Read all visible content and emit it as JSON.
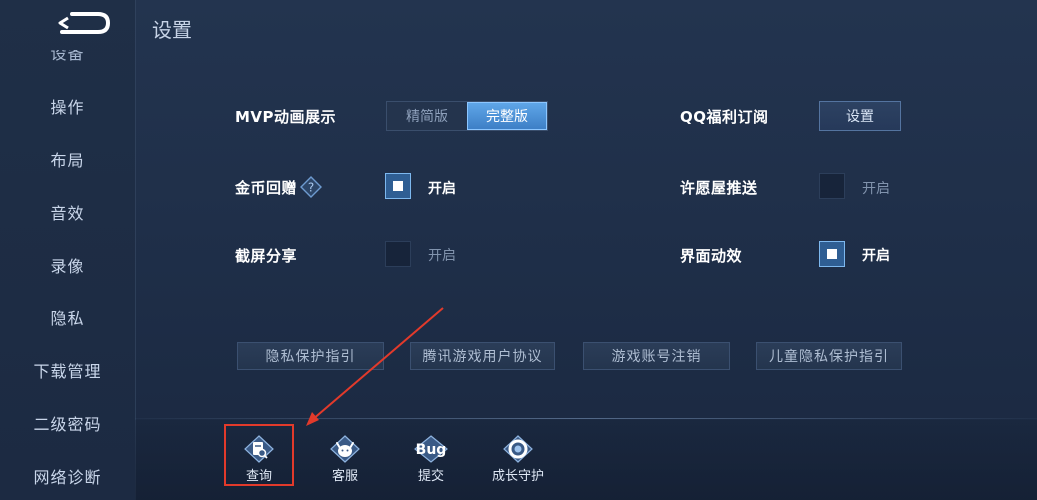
{
  "header": {
    "title": "设置"
  },
  "sidebar": {
    "items": [
      {
        "label": "设备"
      },
      {
        "label": "操作"
      },
      {
        "label": "布局"
      },
      {
        "label": "音效"
      },
      {
        "label": "录像"
      },
      {
        "label": "隐私"
      },
      {
        "label": "下载管理"
      },
      {
        "label": "二级密码"
      },
      {
        "label": "网络诊断"
      }
    ]
  },
  "settings": {
    "mvp": {
      "label": "MVP动画展示",
      "options": [
        "精简版",
        "完整版"
      ],
      "selected": "完整版"
    },
    "qq_welfare": {
      "label": "QQ福利订阅",
      "button": "设置"
    },
    "gold_gift": {
      "label": "金币回赠",
      "checked": true,
      "state_text": "开启"
    },
    "wish_push": {
      "label": "许愿屋推送",
      "checked": false,
      "state_text": "开启"
    },
    "screenshot_share": {
      "label": "截屏分享",
      "checked": false,
      "state_text": "开启"
    },
    "ui_effects": {
      "label": "界面动效",
      "checked": true,
      "state_text": "开启"
    }
  },
  "links": [
    {
      "label": "隐私保护指引"
    },
    {
      "label": "腾讯游戏用户协议"
    },
    {
      "label": "游戏账号注销"
    },
    {
      "label": "儿童隐私保护指引"
    }
  ],
  "toolbar": [
    {
      "label": "查询",
      "icon": "query-icon"
    },
    {
      "label": "客服",
      "icon": "customer-service-icon"
    },
    {
      "label": "提交",
      "icon": "bug-icon",
      "icon_text": "Bug"
    },
    {
      "label": "成长守护",
      "icon": "growth-guard-icon"
    }
  ],
  "colors": {
    "accent": "#4a90d9",
    "annotation": "#e23a2b"
  }
}
